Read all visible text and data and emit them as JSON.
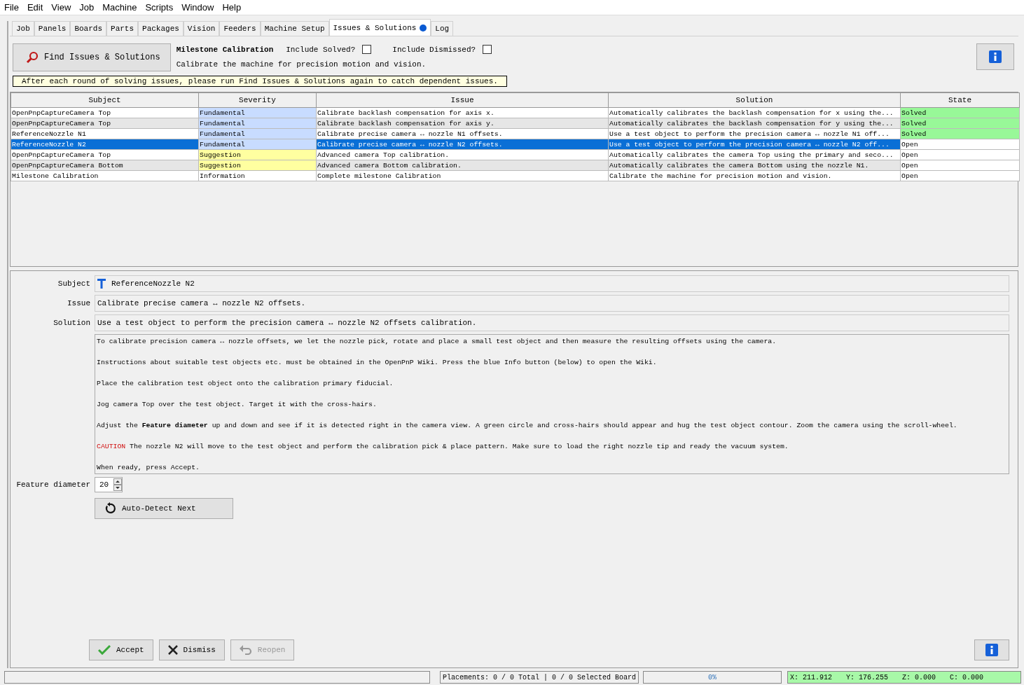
{
  "menu": [
    "File",
    "Edit",
    "View",
    "Job",
    "Machine",
    "Scripts",
    "Window",
    "Help"
  ],
  "tabs": [
    {
      "label": "Job",
      "selected": false,
      "badge": false
    },
    {
      "label": "Panels",
      "selected": false,
      "badge": false
    },
    {
      "label": "Boards",
      "selected": false,
      "badge": false
    },
    {
      "label": "Parts",
      "selected": false,
      "badge": false
    },
    {
      "label": "Packages",
      "selected": false,
      "badge": false
    },
    {
      "label": "Vision",
      "selected": false,
      "badge": false
    },
    {
      "label": "Feeders",
      "selected": false,
      "badge": false
    },
    {
      "label": "Machine Setup",
      "selected": false,
      "badge": false
    },
    {
      "label": "Issues & Solutions",
      "selected": true,
      "badge": true
    },
    {
      "label": "Log",
      "selected": false,
      "badge": false
    }
  ],
  "toolbar": {
    "find_button": "Find Issues & Solutions",
    "milestone_title": "Milestone Calibration",
    "milestone_description": "Calibrate the machine for precision motion and vision.",
    "include_solved": {
      "label": "Include Solved?",
      "checked": false
    },
    "include_dismissed": {
      "label": "Include Dismissed?",
      "checked": false
    }
  },
  "notice": "After each round of solving issues, please run Find Issues & Solutions again to catch dependent issues.",
  "table": {
    "columns": [
      "Subject",
      "Severity",
      "Issue",
      "Solution",
      "State"
    ],
    "rows": [
      {
        "selected": false,
        "cells": [
          {
            "text": "OpenPnpCaptureCamera Top"
          },
          {
            "text": "Fundamental",
            "color": "#c8dcff"
          },
          {
            "text": "Calibrate backlash compensation for axis x."
          },
          {
            "text": "Automatically calibrates the backlash compensation for x using the..."
          },
          {
            "text": "Solved",
            "color": "#98f898"
          }
        ]
      },
      {
        "selected": false,
        "cells": [
          {
            "text": "OpenPnpCaptureCamera Top"
          },
          {
            "text": "Fundamental",
            "color": "#c8dcff"
          },
          {
            "text": "Calibrate backlash compensation for axis y."
          },
          {
            "text": "Automatically calibrates the backlash compensation for y using the..."
          },
          {
            "text": "Solved",
            "color": "#98f898"
          }
        ]
      },
      {
        "selected": false,
        "cells": [
          {
            "text": "ReferenceNozzle N1"
          },
          {
            "text": "Fundamental",
            "color": "#c8dcff"
          },
          {
            "text": "Calibrate precise camera ↔ nozzle N1 offsets."
          },
          {
            "text": "Use a test object to perform the precision camera ↔ nozzle N1 off..."
          },
          {
            "text": "Solved",
            "color": "#98f898"
          }
        ]
      },
      {
        "selected": true,
        "cells": [
          {
            "text": "ReferenceNozzle N2"
          },
          {
            "text": "Fundamental",
            "color": "#c8dcff"
          },
          {
            "text": "Calibrate precise camera ↔ nozzle N2 offsets."
          },
          {
            "text": "Use a test object to perform the precision camera ↔ nozzle N2 off..."
          },
          {
            "text": "Open",
            "color": "#ffffff"
          }
        ]
      },
      {
        "selected": false,
        "cells": [
          {
            "text": "OpenPnpCaptureCamera Top"
          },
          {
            "text": "Suggestion",
            "color": "#ffffa0"
          },
          {
            "text": "Advanced camera Top calibration."
          },
          {
            "text": "Automatically calibrates the camera Top using the primary and seco..."
          },
          {
            "text": "Open",
            "color": "#ffffff"
          }
        ]
      },
      {
        "selected": false,
        "cells": [
          {
            "text": "OpenPnpCaptureCamera Bottom"
          },
          {
            "text": "Suggestion",
            "color": "#ffffa0"
          },
          {
            "text": "Advanced camera Bottom calibration."
          },
          {
            "text": "Automatically calibrates the camera Bottom using the nozzle N1."
          },
          {
            "text": "Open",
            "color": "#ffffff"
          }
        ]
      },
      {
        "selected": false,
        "cells": [
          {
            "text": "Milestone Calibration"
          },
          {
            "text": "Information",
            "color": "#ffffff"
          },
          {
            "text": "Complete milestone Calibration"
          },
          {
            "text": "Calibrate the machine for precision motion and vision."
          },
          {
            "text": "Open",
            "color": "#ffffff"
          }
        ]
      }
    ]
  },
  "detail": {
    "subject_label": "Subject",
    "subject": "ReferenceNozzle N2",
    "issue_label": "Issue",
    "issue": "Calibrate precise camera ↔ nozzle N2 offsets.",
    "solution_label": "Solution",
    "solution": "Use a test object to perform the precision camera ↔ nozzle N2 offsets calibration.",
    "instructions": [
      {
        "kind": "text",
        "text": "To calibrate precision camera ↔ nozzle offsets, we let the nozzle pick, rotate and place a small test object and then measure the resulting offsets using the camera."
      },
      {
        "kind": "text",
        "text": "Instructions about suitable test objects etc. must be obtained in the OpenPnP Wiki. Press the blue Info button (below) to open the Wiki."
      },
      {
        "kind": "text",
        "text": "Place the calibration test object onto the calibration primary fiducial."
      },
      {
        "kind": "text",
        "text": "Jog camera Top over the test object. Target it with the cross-hairs."
      },
      {
        "kind": "text",
        "text": "Adjust the **Feature diameter** up and down and see if it is detected right in the camera view. A green circle and cross-hairs should appear and hug the test object contour. Zoom the camera using the scroll-wheel."
      },
      {
        "kind": "caution",
        "label": "CAUTION",
        "text": "The nozzle N2 will move to the test object and perform the calibration pick & place pattern. Make sure to load the right nozzle tip and ready the vacuum system."
      },
      {
        "kind": "text",
        "text": "When ready, press Accept."
      }
    ],
    "feature_label": "Feature diameter",
    "feature_value": "20",
    "auto_detect_button": "Auto-Detect Next"
  },
  "actions": [
    {
      "kind": "accept",
      "label": "Accept",
      "disabled": false
    },
    {
      "kind": "dismiss",
      "label": "Dismiss",
      "disabled": false
    },
    {
      "kind": "reopen",
      "label": "Reopen",
      "disabled": true
    }
  ],
  "status_bar": {
    "placements": "Placements: 0 / 0 Total | 0 / 0 Selected Board",
    "progress": {
      "level": 0,
      "text": "0%"
    },
    "coords": [
      "X: 211.912",
      "Y: 176.255",
      "Z: 0.000",
      "C: 0.000"
    ]
  }
}
